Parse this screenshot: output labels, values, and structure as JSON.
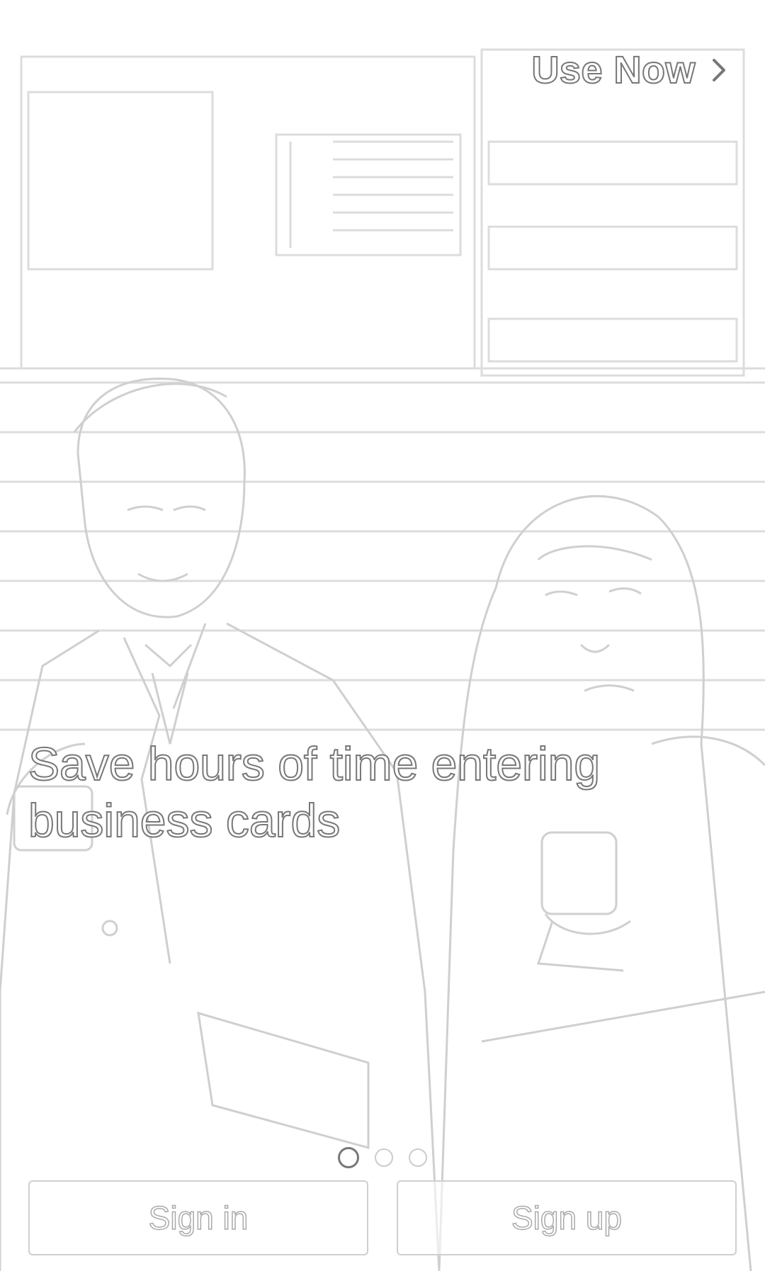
{
  "header": {
    "use_now_label": "Use Now",
    "use_now_icon": "chevron-right-icon"
  },
  "slide": {
    "headline": "Save hours of time entering business cards",
    "current_page": 1,
    "total_pages": 3
  },
  "actions": {
    "sign_in_label": "Sign in",
    "sign_up_label": "Sign up"
  },
  "colors": {
    "background": "#ffffff",
    "line_art": "#d9d9d9",
    "text_outline": "#777777",
    "button_border": "#cfcfcf"
  }
}
